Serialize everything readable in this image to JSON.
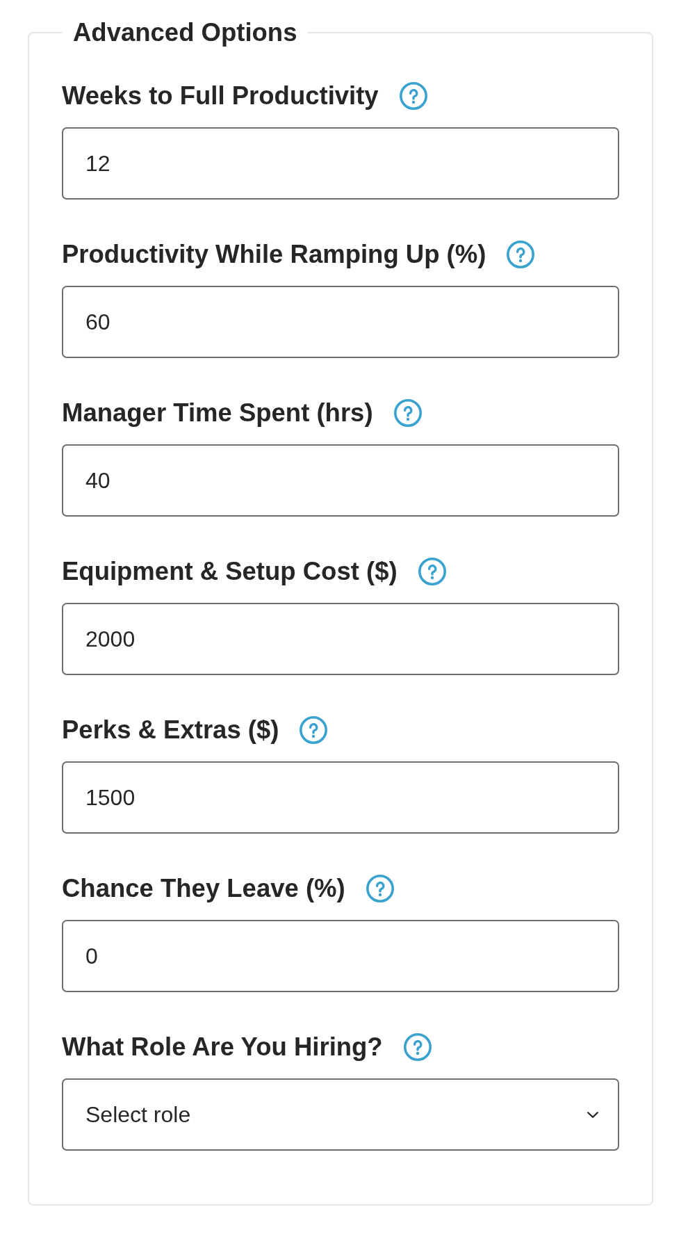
{
  "fieldset": {
    "legend": "Advanced Options"
  },
  "fields": [
    {
      "kind": "input",
      "label": "Weeks to Full Productivity",
      "value": "12"
    },
    {
      "kind": "input",
      "label": "Productivity While Ramping Up (%)",
      "value": "60"
    },
    {
      "kind": "input",
      "label": "Manager Time Spent (hrs)",
      "value": "40"
    },
    {
      "kind": "input",
      "label": "Equipment & Setup Cost ($)",
      "value": "2000"
    },
    {
      "kind": "input",
      "label": "Perks & Extras ($)",
      "value": "1500"
    },
    {
      "kind": "input",
      "label": "Chance They Leave (%)",
      "value": "0"
    },
    {
      "kind": "select",
      "label": "What Role Are You Hiring?",
      "value": "Select role"
    }
  ]
}
